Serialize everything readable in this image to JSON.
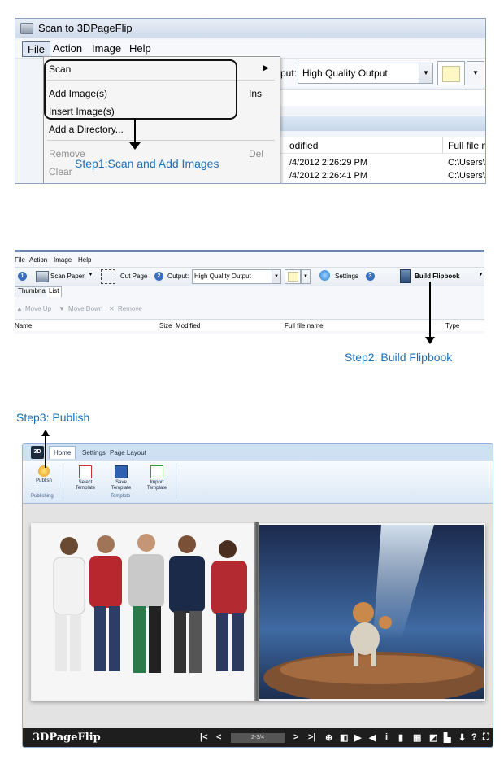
{
  "panel1": {
    "window_title": "Scan to 3DPageFlip",
    "menu": [
      "File",
      "Action",
      "Image",
      "Help"
    ],
    "file_menu": {
      "scan": "Scan",
      "add_images": "Add Image(s)",
      "add_images_shortcut": "Ins",
      "insert_images": "Insert Image(s)",
      "add_directory": "Add a Directory...",
      "remove": "Remove",
      "remove_shortcut": "Del",
      "clear": "Clear"
    },
    "output_label": "put:",
    "output_value": "High Quality Output",
    "col_modified": "odified",
    "col_fullname": "Full file name",
    "rows": [
      {
        "modified": "/4/2012 2:26:29 PM",
        "path": "C:\\Users\\Pul"
      },
      {
        "modified": "/4/2012 2:26:41 PM",
        "path": "C:\\Users\\Pul"
      }
    ]
  },
  "step1": "Step1:Scan and Add Images",
  "panel2": {
    "menu": [
      "File",
      "Action",
      "Image",
      "Help"
    ],
    "scan_paper": "Scan Paper",
    "cut_page": "Cut Page",
    "output_label": "Output:",
    "output_value": "High Quality Output",
    "settings": "Settings",
    "build": "Build Flipbook",
    "tabs": [
      "Thumbnail",
      "List"
    ],
    "move_up": "Move Up",
    "move_down": "Move Down",
    "remove": "Remove",
    "columns": [
      "Name",
      "Size",
      "Modified",
      "Full file name",
      "Type"
    ],
    "step_numbers": [
      "1",
      "2",
      "3"
    ]
  },
  "step2": "Step2: Build Flipbook",
  "step3": "Step3: Publish",
  "panel3": {
    "logo": "3D",
    "tabs": [
      "Home",
      "Settings",
      "Page Layout"
    ],
    "buttons": [
      {
        "label1": "Publish",
        "label2": ""
      },
      {
        "label1": "Select",
        "label2": "Template"
      },
      {
        "label1": "Save",
        "label2": "Template"
      },
      {
        "label1": "Import",
        "label2": "Template"
      }
    ],
    "group_publishing": "Publishing",
    "group_template": "Template",
    "brand": "3DPageFlip",
    "page_number": "2-3/4"
  },
  "colors": {
    "accent_blue": "#1b6fb7",
    "ribbon": "#cfe0f3",
    "control_bar": "#1e1e1e"
  }
}
